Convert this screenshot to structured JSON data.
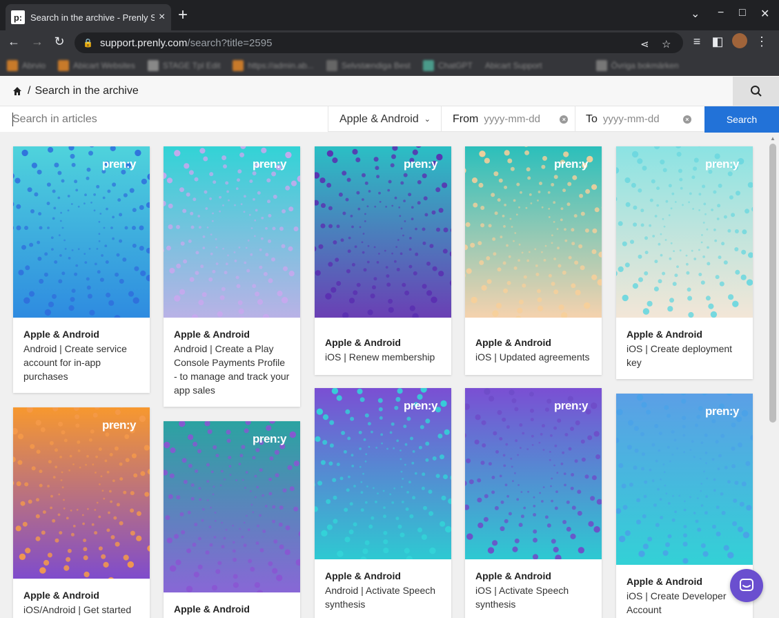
{
  "browser": {
    "tab_title": "Search in the archive - Prenly S",
    "favicon_text": "p:",
    "url_host": "support.prenly.com",
    "url_path": "/search?title=2595",
    "bookmarks": [
      "Abrvio",
      "Abicart Websites",
      "STAGE Tpl Edit",
      "https://admin.ab...",
      "Selvstændiga Best",
      "ChatGPT",
      "Abicart Support",
      "Övriga bokmärken"
    ]
  },
  "breadcrumb": {
    "separator": "/",
    "title": "Search in the archive"
  },
  "filters": {
    "search_placeholder": "Search in articles",
    "platform_value": "Apple & Android",
    "from_label": "From",
    "to_label": "To",
    "date_placeholder": "yyyy-mm-dd",
    "search_button": "Search"
  },
  "logo_text": "pren:y",
  "cards": [
    {
      "category": "Apple & Android",
      "title": "Android | Create service account for in-app purchases",
      "top": "#4fd3dc",
      "bottom": "#2e8be0",
      "dots": "#2f6fdc"
    },
    {
      "category": "Apple & Android",
      "title": "Android | Create a Play Console Payments Profile - to manage and track your app sales",
      "top": "#32d3d6",
      "bottom": "#b9b2e6",
      "dots": "#c8a8ee"
    },
    {
      "category": "Apple & Android",
      "title": "iOS | Renew membership",
      "top": "#2bbfc4",
      "bottom": "#6a3fb4",
      "dots": "#5a2fb0"
    },
    {
      "category": "Apple & Android",
      "title": "iOS | Updated agreements",
      "top": "#2bbfbb",
      "bottom": "#f5d2ae",
      "dots": "#f7cf9a"
    },
    {
      "category": "Apple & Android",
      "title": "iOS | Create deployment key",
      "top": "#8be3e3",
      "bottom": "#f3e6d7",
      "dots": "#6cd7df"
    },
    {
      "category": "Apple & Android",
      "title": "iOS/Android | Get started",
      "top": "#f7982f",
      "bottom": "#7f4ccc",
      "dots": "#f59a4a"
    },
    {
      "category": "Apple & Android",
      "title": "",
      "top": "#2ba3a1",
      "bottom": "#8867d6",
      "dots": "#8a55d2"
    },
    {
      "category": "Apple & Android",
      "title": "Android | Activate Speech synthesis",
      "top": "#7a4fd3",
      "bottom": "#2ec9d2",
      "dots": "#33d3d8"
    },
    {
      "category": "Apple & Android",
      "title": "iOS | Activate Speech synthesis",
      "top": "#7a4fd3",
      "bottom": "#2ec9d2",
      "dots": "#6e4cc8"
    },
    {
      "category": "Apple & Android",
      "title": "iOS | Create Developer Account",
      "top": "#5b9fe6",
      "bottom": "#33d1d6",
      "dots": "#4aa2e8"
    }
  ]
}
